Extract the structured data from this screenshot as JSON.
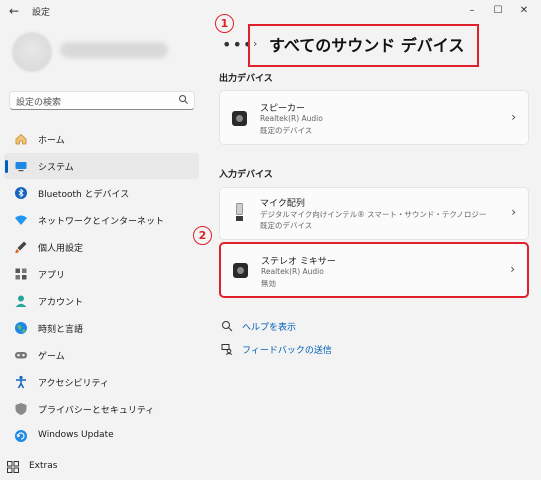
{
  "window": {
    "title": "設定",
    "controls": {
      "minimize": "–",
      "maximize": "☐",
      "close": "✕"
    }
  },
  "search": {
    "placeholder": "設定の検索"
  },
  "sidebar": {
    "items": [
      {
        "label": "ホーム",
        "icon": "home-icon"
      },
      {
        "label": "システム",
        "icon": "system-icon",
        "active": true
      },
      {
        "label": "Bluetooth とデバイス",
        "icon": "bluetooth-icon"
      },
      {
        "label": "ネットワークとインターネット",
        "icon": "network-icon"
      },
      {
        "label": "個人用設定",
        "icon": "brush-icon"
      },
      {
        "label": "アプリ",
        "icon": "apps-icon"
      },
      {
        "label": "アカウント",
        "icon": "account-icon"
      },
      {
        "label": "時刻と言語",
        "icon": "globe-icon"
      },
      {
        "label": "ゲーム",
        "icon": "gamepad-icon"
      },
      {
        "label": "アクセシビリティ",
        "icon": "accessibility-icon"
      },
      {
        "label": "プライバシーとセキュリティ",
        "icon": "shield-icon"
      },
      {
        "label": "Windows Update",
        "icon": "update-icon"
      },
      {
        "label": "Extras",
        "icon": "extras-icon"
      }
    ]
  },
  "breadcrumb": {
    "ellipsis": "•••",
    "chevron": "›",
    "title": "すべてのサウンド デバイス"
  },
  "markers": {
    "one": "1",
    "two": "2"
  },
  "output_section": {
    "title": "出力デバイス",
    "devices": [
      {
        "name": "スピーカー",
        "driver": "Realtek(R) Audio",
        "status": "既定のデバイス"
      }
    ]
  },
  "input_section": {
    "title": "入力デバイス",
    "devices": [
      {
        "name": "マイク配列",
        "driver": "デジタルマイク向けインテル® スマート・サウンド・テクノロジー",
        "status": "既定のデバイス"
      },
      {
        "name": "ステレオ ミキサー",
        "driver": "Realtek(R) Audio",
        "status": "無効"
      }
    ]
  },
  "links": {
    "help": "ヘルプを表示",
    "feedback": "フィードバックの送信"
  },
  "colors": {
    "accent": "#005fb8",
    "highlight": "#e0202a"
  }
}
